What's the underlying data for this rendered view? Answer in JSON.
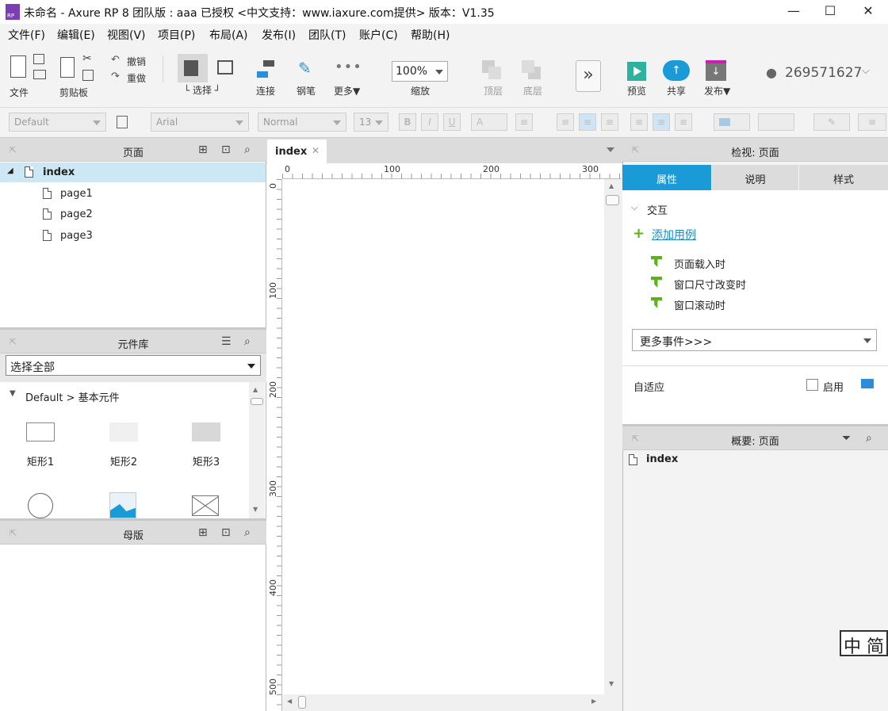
{
  "window": {
    "title": "未命名 - Axure RP 8 团队版 : aaa 已授权      <中文支持：www.iaxure.com提供> 版本：V1.35",
    "icon_text": "RP",
    "minimize": "—",
    "maximize": "☐",
    "close": "✕"
  },
  "menu": [
    "文件(F)",
    "编辑(E)",
    "视图(V)",
    "项目(P)",
    "布局(A)",
    "发布(I)",
    "团队(T)",
    "账户(C)",
    "帮助(H)"
  ],
  "toolbar": {
    "file": "文件",
    "clipboard": "剪贴板",
    "undo": "撤销",
    "redo": "重做",
    "select": "选择",
    "connect": "连接",
    "pen": "钢笔",
    "more": "更多▼",
    "zoom_value": "100%",
    "zoom": "缩放",
    "top": "顶层",
    "bottom": "底层",
    "preview": "预览",
    "share": "共享",
    "publish": "发布▼",
    "account": "269571627"
  },
  "format": {
    "style": "Default",
    "font": "Arial",
    "weight": "Normal",
    "size": "13",
    "bold": "B",
    "italic": "I",
    "underline": "U",
    "color": "A"
  },
  "pages_panel": {
    "title": "页面",
    "root": "index",
    "items": [
      "page1",
      "page2",
      "page3"
    ]
  },
  "library_panel": {
    "title": "元件库",
    "select_value": "选择全部",
    "group": "Default > 基本元件",
    "widgets": [
      "矩形1",
      "矩形2",
      "矩形3"
    ]
  },
  "masters_panel": {
    "title": "母版"
  },
  "canvas": {
    "tab": "index",
    "h_ticks": [
      "0",
      "100",
      "200",
      "300"
    ],
    "v_ticks": [
      "0",
      "100",
      "200",
      "300",
      "400",
      "500"
    ]
  },
  "inspector": {
    "title": "检视: 页面",
    "tabs": [
      "属性",
      "说明",
      "样式"
    ],
    "section": "交互",
    "add_case": "添加用例",
    "events": [
      "页面载入时",
      "窗口尺寸改变时",
      "窗口滚动时"
    ],
    "more_events": "更多事件>>>",
    "adaptive": "自适应",
    "enable": "启用"
  },
  "outline": {
    "title": "概要: 页面",
    "root": "index"
  },
  "ime": "中 简",
  "colors": {
    "accent": "#1a9ad6",
    "selected_row": "#cce8f4",
    "green": "#5ab31a"
  }
}
